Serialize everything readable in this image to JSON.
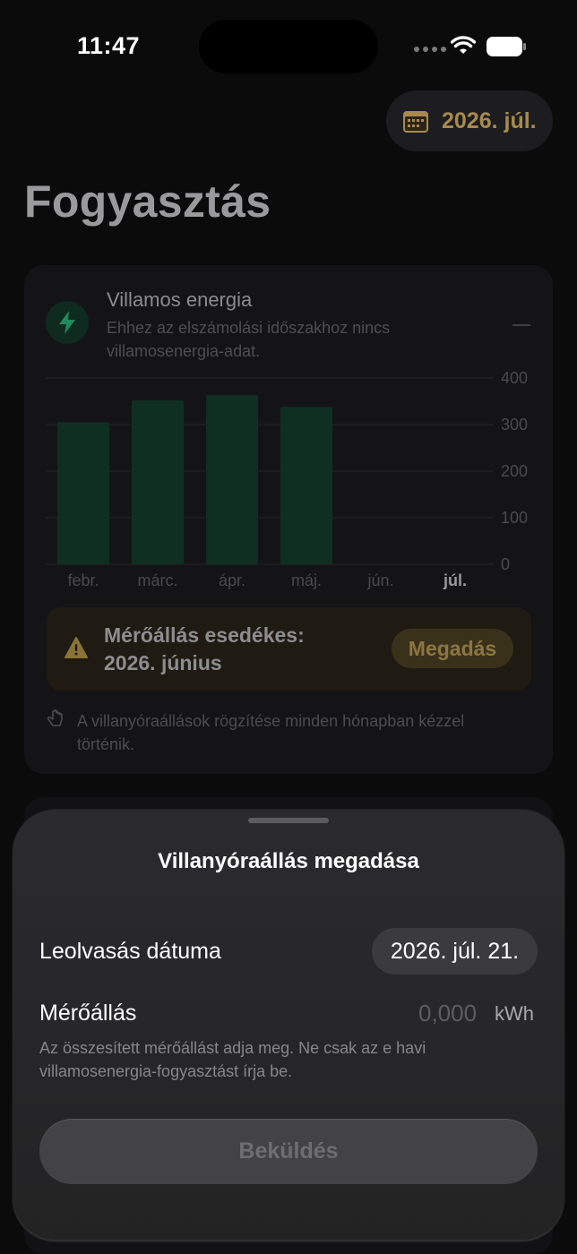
{
  "status_bar": {
    "time": "11:47"
  },
  "header": {
    "period_label": "2026. júl."
  },
  "page": {
    "title": "Fogyasztás"
  },
  "energy_card": {
    "title": "Villamos energia",
    "subtitle": "Ehhez az elszámolási időszakhoz nincs villamosenergia-adat.",
    "value_placeholder": "—",
    "alert": {
      "line1": "Mérőállás esedékes:",
      "line2": "2026. június",
      "button": "Megadás"
    },
    "note": "A villanyóraállások rögzítése minden hónapban kézzel történik."
  },
  "chart_data": {
    "type": "bar",
    "categories": [
      "febr.",
      "márc.",
      "ápr.",
      "máj.",
      "jún.",
      "júl."
    ],
    "values": [
      305,
      352,
      363,
      338,
      null,
      null
    ],
    "highlighted_category": "júl.",
    "ylim": [
      0,
      400
    ],
    "yticks": [
      "0",
      "100",
      "200",
      "300",
      "400"
    ],
    "grid": true,
    "bar_color": "#0f2f22"
  },
  "sheet": {
    "title": "Villanyóraállás megadása",
    "date_label": "Leolvasás dátuma",
    "date_value": "2026. júl. 21.",
    "reading_label": "Mérőállás",
    "reading_placeholder": "0,000",
    "unit": "kWh",
    "help": "Az összesített mérőállást adja meg. Ne csak az e havi villamosenergia-fogyasztást írja be.",
    "submit": "Beküldés"
  },
  "colors": {
    "accent_gold": "#a88a4e",
    "energy_green": "#1f8a5a"
  },
  "icons": {
    "period": "calendar-icon",
    "energy": "bolt-icon",
    "alert": "warning-icon",
    "note": "hand-tap-icon"
  }
}
